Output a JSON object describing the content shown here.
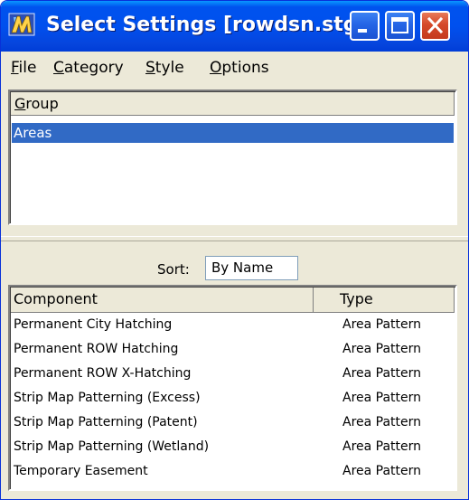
{
  "window": {
    "title": "Select Settings [rowdsn.stg]"
  },
  "menu": {
    "items": [
      "File",
      "Category",
      "Style",
      "Options"
    ]
  },
  "group_list": {
    "header": "Group",
    "items": [
      "Areas"
    ],
    "selected": "Areas"
  },
  "sort": {
    "label": "Sort:",
    "value": "By Name"
  },
  "component_list": {
    "headers": {
      "component": "Component",
      "type": "Type"
    },
    "rows": [
      {
        "component": "Permanent City Hatching",
        "type": "Area Pattern"
      },
      {
        "component": "Permanent ROW Hatching",
        "type": "Area Pattern"
      },
      {
        "component": "Permanent ROW X-Hatching",
        "type": "Area Pattern"
      },
      {
        "component": "Strip Map Patterning (Excess)",
        "type": "Area Pattern"
      },
      {
        "component": "Strip Map Patterning (Patent)",
        "type": "Area Pattern"
      },
      {
        "component": "Strip Map Patterning (Wetland)",
        "type": "Area Pattern"
      },
      {
        "component": "Temporary Easement",
        "type": "Area Pattern"
      }
    ]
  },
  "icons": {
    "app": "microstation-settings-icon",
    "minimize": "minimize-icon",
    "maximize": "maximize-icon",
    "close": "close-icon"
  },
  "colors": {
    "titlebar": "#0053EE",
    "selection": "#316AC5",
    "close_button": "#D5492A",
    "face": "#ECE9D8"
  }
}
